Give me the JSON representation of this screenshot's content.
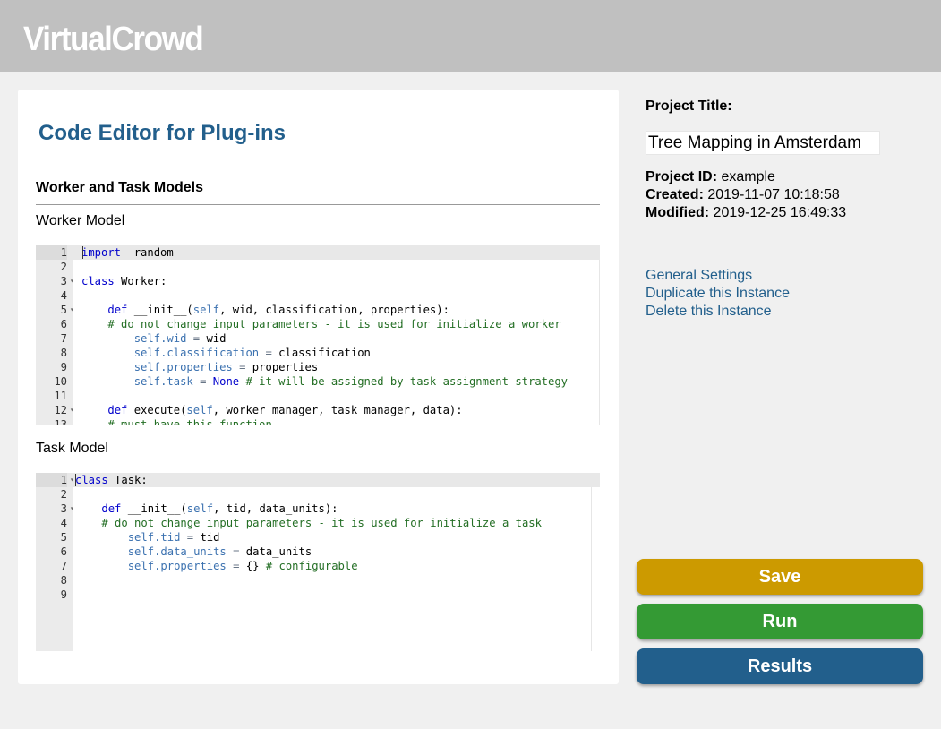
{
  "app": {
    "brand": "VirtualCrowd"
  },
  "colors": {
    "header_bg": "#c0c0c0",
    "title": "#225f8c",
    "save": "#cc9a00",
    "run": "#349a34",
    "results": "#225f8c"
  },
  "main": {
    "title": "Code Editor for Plug-ins",
    "section_heading": "Worker and Task Models",
    "worker_label": "Worker Model",
    "task_label": "Task Model"
  },
  "worker_editor": {
    "lines": [
      {
        "num": "1",
        "fold": false,
        "tokens": [
          [
            "kw",
            "import"
          ],
          [
            "",
            "  random"
          ]
        ]
      },
      {
        "num": "2",
        "fold": false,
        "tokens": []
      },
      {
        "num": "3",
        "fold": true,
        "tokens": [
          [
            "kw",
            "class"
          ],
          [
            "",
            " Worker:"
          ]
        ]
      },
      {
        "num": "4",
        "fold": false,
        "tokens": []
      },
      {
        "num": "5",
        "fold": true,
        "tokens": [
          [
            "",
            "    "
          ],
          [
            "kw",
            "def"
          ],
          [
            "",
            " __init__("
          ],
          [
            "slf",
            "self"
          ],
          [
            "",
            ", wid, classification, properties):"
          ]
        ]
      },
      {
        "num": "6",
        "fold": false,
        "tokens": [
          [
            "",
            "    "
          ],
          [
            "cm",
            "# do not change input parameters - it is used for initialize a worker"
          ]
        ]
      },
      {
        "num": "7",
        "fold": false,
        "tokens": [
          [
            "",
            "        "
          ],
          [
            "slf",
            "self"
          ],
          [
            "nn",
            ".wid"
          ],
          [
            "op",
            " ="
          ],
          [
            "",
            " wid"
          ]
        ]
      },
      {
        "num": "8",
        "fold": false,
        "tokens": [
          [
            "",
            "        "
          ],
          [
            "slf",
            "self"
          ],
          [
            "nn",
            ".classification"
          ],
          [
            "op",
            " ="
          ],
          [
            "",
            " classification"
          ]
        ]
      },
      {
        "num": "9",
        "fold": false,
        "tokens": [
          [
            "",
            "        "
          ],
          [
            "slf",
            "self"
          ],
          [
            "nn",
            ".properties"
          ],
          [
            "op",
            " ="
          ],
          [
            "",
            " properties"
          ]
        ]
      },
      {
        "num": "10",
        "fold": false,
        "tokens": [
          [
            "",
            "        "
          ],
          [
            "slf",
            "self"
          ],
          [
            "nn",
            ".task"
          ],
          [
            "op",
            " ="
          ],
          [
            "",
            " "
          ],
          [
            "kw",
            "None"
          ],
          [
            "",
            " "
          ],
          [
            "cm",
            "# it will be assigned by task assignment strategy"
          ]
        ]
      },
      {
        "num": "11",
        "fold": false,
        "tokens": []
      },
      {
        "num": "12",
        "fold": true,
        "tokens": [
          [
            "",
            "    "
          ],
          [
            "kw",
            "def"
          ],
          [
            "",
            " execute("
          ],
          [
            "slf",
            "self"
          ],
          [
            "",
            ", worker_manager, task_manager, data):"
          ]
        ]
      },
      {
        "num": "13",
        "fold": false,
        "tokens": [
          [
            "",
            "    "
          ],
          [
            "cm",
            "# must have this function"
          ]
        ]
      }
    ]
  },
  "task_editor": {
    "lines": [
      {
        "num": "1",
        "fold": true,
        "tokens": [
          [
            "kw",
            "class"
          ],
          [
            "",
            " Task:"
          ]
        ]
      },
      {
        "num": "2",
        "fold": false,
        "tokens": []
      },
      {
        "num": "3",
        "fold": true,
        "tokens": [
          [
            "",
            "    "
          ],
          [
            "kw",
            "def"
          ],
          [
            "",
            " __init__("
          ],
          [
            "slf",
            "self"
          ],
          [
            "",
            ", tid, data_units):"
          ]
        ]
      },
      {
        "num": "4",
        "fold": false,
        "tokens": [
          [
            "",
            "    "
          ],
          [
            "cm",
            "# do not change input parameters - it is used for initialize a task"
          ]
        ]
      },
      {
        "num": "5",
        "fold": false,
        "tokens": [
          [
            "",
            "        "
          ],
          [
            "slf",
            "self"
          ],
          [
            "nn",
            ".tid"
          ],
          [
            "op",
            " ="
          ],
          [
            "",
            " tid"
          ]
        ]
      },
      {
        "num": "6",
        "fold": false,
        "tokens": [
          [
            "",
            "        "
          ],
          [
            "slf",
            "self"
          ],
          [
            "nn",
            ".data_units"
          ],
          [
            "op",
            " ="
          ],
          [
            "",
            " data_units"
          ]
        ]
      },
      {
        "num": "7",
        "fold": false,
        "tokens": [
          [
            "",
            "        "
          ],
          [
            "slf",
            "self"
          ],
          [
            "nn",
            ".properties"
          ],
          [
            "op",
            " ="
          ],
          [
            "",
            " {} "
          ],
          [
            "cm",
            "# configurable"
          ]
        ]
      },
      {
        "num": "8",
        "fold": false,
        "tokens": []
      },
      {
        "num": "9",
        "fold": false,
        "tokens": []
      }
    ]
  },
  "project": {
    "title_label": "Project Title:",
    "title_value": "Tree Mapping in Amsterdam",
    "id_label": "Project ID:",
    "id_value": " example",
    "created_label": "Created:",
    "created_value": " 2019-11-07 10:18:58",
    "modified_label": "Modified:",
    "modified_value": " 2019-12-25 16:49:33"
  },
  "links": {
    "general_settings": "General Settings",
    "duplicate": "Duplicate this Instance",
    "delete": "Delete this Instance"
  },
  "buttons": {
    "save": "Save",
    "run": "Run",
    "results": "Results"
  }
}
